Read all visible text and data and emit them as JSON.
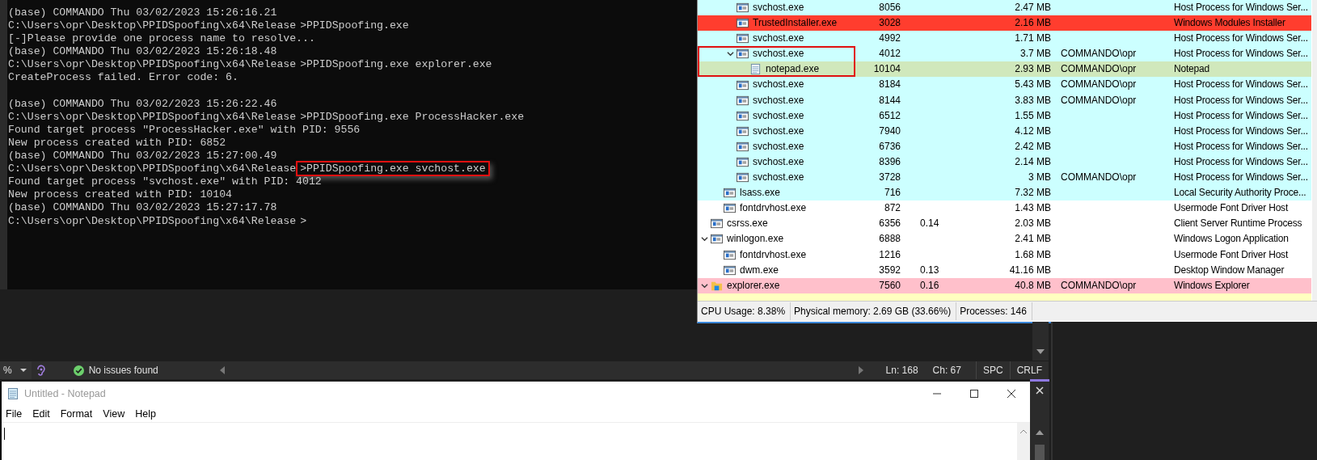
{
  "terminal": {
    "lines": [
      {
        "kind": "output",
        "text": "(base) COMMANDO Thu 03/02/2023 15:26:16.21"
      },
      {
        "kind": "command",
        "prompt": "C:\\Users\\opr\\Desktop\\PPIDSpoofing\\x64\\Release",
        "command": ">PPIDSpoofing.exe",
        "highlighted": false
      },
      {
        "kind": "output",
        "text": "[-]Please provide one process name to resolve..."
      },
      {
        "kind": "output",
        "text": "(base) COMMANDO Thu 03/02/2023 15:26:18.48"
      },
      {
        "kind": "command",
        "prompt": "C:\\Users\\opr\\Desktop\\PPIDSpoofing\\x64\\Release",
        "command": ">PPIDSpoofing.exe explorer.exe",
        "highlighted": false
      },
      {
        "kind": "output",
        "text": "CreateProcess failed. Error code: 6."
      },
      {
        "kind": "blank"
      },
      {
        "kind": "output",
        "text": "(base) COMMANDO Thu 03/02/2023 15:26:22.46"
      },
      {
        "kind": "command",
        "prompt": "C:\\Users\\opr\\Desktop\\PPIDSpoofing\\x64\\Release",
        "command": ">PPIDSpoofing.exe ProcessHacker.exe",
        "highlighted": false
      },
      {
        "kind": "output",
        "text": "Found target process \"ProcessHacker.exe\" with PID: 9556"
      },
      {
        "kind": "output",
        "text": "New process created with PID: 6852"
      },
      {
        "kind": "output",
        "text": "(base) COMMANDO Thu 03/02/2023 15:27:00.49"
      },
      {
        "kind": "command",
        "prompt": "C:\\Users\\opr\\Desktop\\PPIDSpoofing\\x64\\Release",
        "command": ">PPIDSpoofing.exe svchost.exe",
        "highlighted": true
      },
      {
        "kind": "output",
        "text": "Found target process \"svchost.exe\" with PID: 4012"
      },
      {
        "kind": "output",
        "text": "New process created with PID: 10104"
      },
      {
        "kind": "output",
        "text": "(base) COMMANDO Thu 03/02/2023 15:27:17.78"
      },
      {
        "kind": "command",
        "prompt": "C:\\Users\\opr\\Desktop\\PPIDSpoofing\\x64\\Release",
        "command": ">",
        "highlighted": false
      }
    ]
  },
  "process_table": {
    "rows": [
      {
        "children": [
          {
            "children": [
              {
                "kind": "window",
                "name": "svchost.exe",
                "pid": "8056",
                "memory": "2.47 MB",
                "description": "Host Process for Windows Ser...",
                "color": "#ccffff",
                "highlighted": false
              },
              {
                "kind": "window",
                "name": "TrustedInstaller.exe",
                "pid": "3028",
                "memory": "2.16 MB",
                "description": "Windows Modules Installer",
                "color": "#ff3d2e",
                "highlighted": false
              },
              {
                "kind": "window",
                "name": "svchost.exe",
                "pid": "4992",
                "memory": "1.71 MB",
                "description": "Host Process for Windows Ser...",
                "color": "#ccffff",
                "highlighted": false
              },
              {
                "kind": "window",
                "name": "svchost.exe",
                "pid": "4012",
                "memory": "3.7 MB",
                "user": "COMMANDO\\opr",
                "description": "Host Process for Windows Ser...",
                "color": "#ccffff",
                "highlighted": true,
                "expanded": true,
                "children": [
                  {
                    "kind": "notepad",
                    "name": "notepad.exe",
                    "pid": "10104",
                    "memory": "2.93 MB",
                    "user": "COMMANDO\\opr",
                    "description": "Notepad",
                    "color": "#d0e8bc",
                    "highlighted": true
                  }
                ]
              },
              {
                "kind": "window",
                "name": "svchost.exe",
                "pid": "8184",
                "memory": "5.43 MB",
                "user": "COMMANDO\\opr",
                "description": "Host Process for Windows Ser...",
                "color": "#ccffff",
                "highlighted": false
              },
              {
                "kind": "window",
                "name": "svchost.exe",
                "pid": "8144",
                "memory": "3.83 MB",
                "user": "COMMANDO\\opr",
                "description": "Host Process for Windows Ser...",
                "color": "#ccffff",
                "highlighted": false
              },
              {
                "kind": "window",
                "name": "svchost.exe",
                "pid": "6512",
                "memory": "1.55 MB",
                "description": "Host Process for Windows Ser...",
                "color": "#ccffff",
                "highlighted": false
              },
              {
                "kind": "window",
                "name": "svchost.exe",
                "pid": "7940",
                "memory": "4.12 MB",
                "description": "Host Process for Windows Ser...",
                "color": "#ccffff",
                "highlighted": false
              },
              {
                "kind": "window",
                "name": "svchost.exe",
                "pid": "6736",
                "memory": "2.42 MB",
                "description": "Host Process for Windows Ser...",
                "color": "#ccffff",
                "highlighted": false
              },
              {
                "kind": "window",
                "name": "svchost.exe",
                "pid": "8396",
                "memory": "2.14 MB",
                "description": "Host Process for Windows Ser...",
                "color": "#ccffff",
                "highlighted": false
              },
              {
                "kind": "window",
                "name": "svchost.exe",
                "pid": "3728",
                "memory": "3 MB",
                "user": "COMMANDO\\opr",
                "description": "Host Process for Windows Ser...",
                "color": "#ccffff",
                "highlighted": false
              }
            ]
          },
          {
            "kind": "window",
            "name": "lsass.exe",
            "pid": "716",
            "memory": "7.32 MB",
            "description": "Local Security Authority Proce...",
            "color": "#ccffff",
            "highlighted": false
          },
          {
            "kind": "window",
            "name": "fontdrvhost.exe",
            "pid": "872",
            "memory": "1.43 MB",
            "description": "Usermode Font Driver Host",
            "color": "#ffffff",
            "highlighted": false
          }
        ]
      },
      {
        "kind": "window",
        "name": "csrss.exe",
        "pid": "6356",
        "cpu": "0.14",
        "memory": "2.03 MB",
        "description": "Client Server Runtime Process",
        "color": "#ffffff",
        "highlighted": false
      },
      {
        "kind": "window",
        "name": "winlogon.exe",
        "pid": "6888",
        "memory": "2.41 MB",
        "description": "Windows Logon Application",
        "color": "#ffffff",
        "highlighted": false,
        "expanded": true,
        "children": [
          {
            "kind": "window",
            "name": "fontdrvhost.exe",
            "pid": "1216",
            "memory": "1.68 MB",
            "description": "Usermode Font Driver Host",
            "color": "#ffffff",
            "highlighted": false
          },
          {
            "kind": "window",
            "name": "dwm.exe",
            "pid": "3592",
            "cpu": "0.13",
            "memory": "41.16 MB",
            "description": "Desktop Window Manager",
            "color": "#ffffff",
            "highlighted": false
          }
        ]
      },
      {
        "kind": "explorer",
        "name": "explorer.exe",
        "pid": "7560",
        "cpu": "0.16",
        "memory": "40.8 MB",
        "user": "COMMANDO\\opr",
        "description": "Windows Explorer",
        "color": "#ffc0cb",
        "highlighted": false,
        "expanded": true
      }
    ]
  },
  "process_status_bar": [
    "CPU Usage: 8.38%",
    "Physical memory: 2.69 GB (33.66%)",
    "Processes: 146"
  ],
  "editor_status_bar": {
    "zoom": "%",
    "issues": "No issues found",
    "line": "Ln: 168",
    "column": "Ch: 67",
    "indent": "SPC",
    "line_ending": "CRLF"
  },
  "notepad": {
    "title": "Untitled - Notepad",
    "menu": [
      "File",
      "Edit",
      "Format",
      "View",
      "Help"
    ]
  }
}
